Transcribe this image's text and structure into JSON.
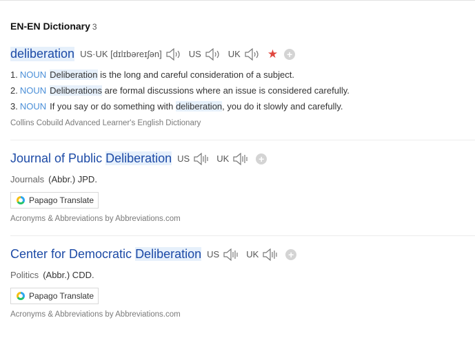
{
  "header": {
    "title": "EN-EN Dictionary",
    "count": "3"
  },
  "entry1": {
    "word": "deliberation",
    "pron_label": "US·UK [dɪlɪbəreɪʃən]",
    "us_label": "US",
    "uk_label": "UK",
    "star": "★",
    "plus": "+",
    "definitions": [
      {
        "num": "1.",
        "pos": "NOUN",
        "hl": "Deliberation",
        "after": " is the long and careful consideration of a subject."
      },
      {
        "num": "2.",
        "pos": "NOUN",
        "hl": "Deliberations",
        "after": " are formal discussions where an issue is considered carefully."
      },
      {
        "num": "3.",
        "pos": "NOUN",
        "before": "If you say or do something with ",
        "hl": "deliberation",
        "after": ", you do it slowly and carefully."
      }
    ],
    "source": "Collins Cobuild Advanced Learner's English Dictionary"
  },
  "entry2": {
    "title_plain": "Journal of Public ",
    "title_hl": "Deliberation",
    "us_label": "US",
    "uk_label": "UK",
    "plus": "+",
    "category": "Journals",
    "abbr": "(Abbr.) JPD.",
    "button": "Papago Translate",
    "source": "Acronyms & Abbreviations by Abbreviations.com"
  },
  "entry3": {
    "title_plain": "Center for Democratic ",
    "title_hl": "Deliberation",
    "us_label": "US",
    "uk_label": "UK",
    "plus": "+",
    "category": "Politics",
    "abbr": "(Abbr.) CDD.",
    "button": "Papago Translate",
    "source": "Acronyms & Abbreviations by Abbreviations.com"
  }
}
